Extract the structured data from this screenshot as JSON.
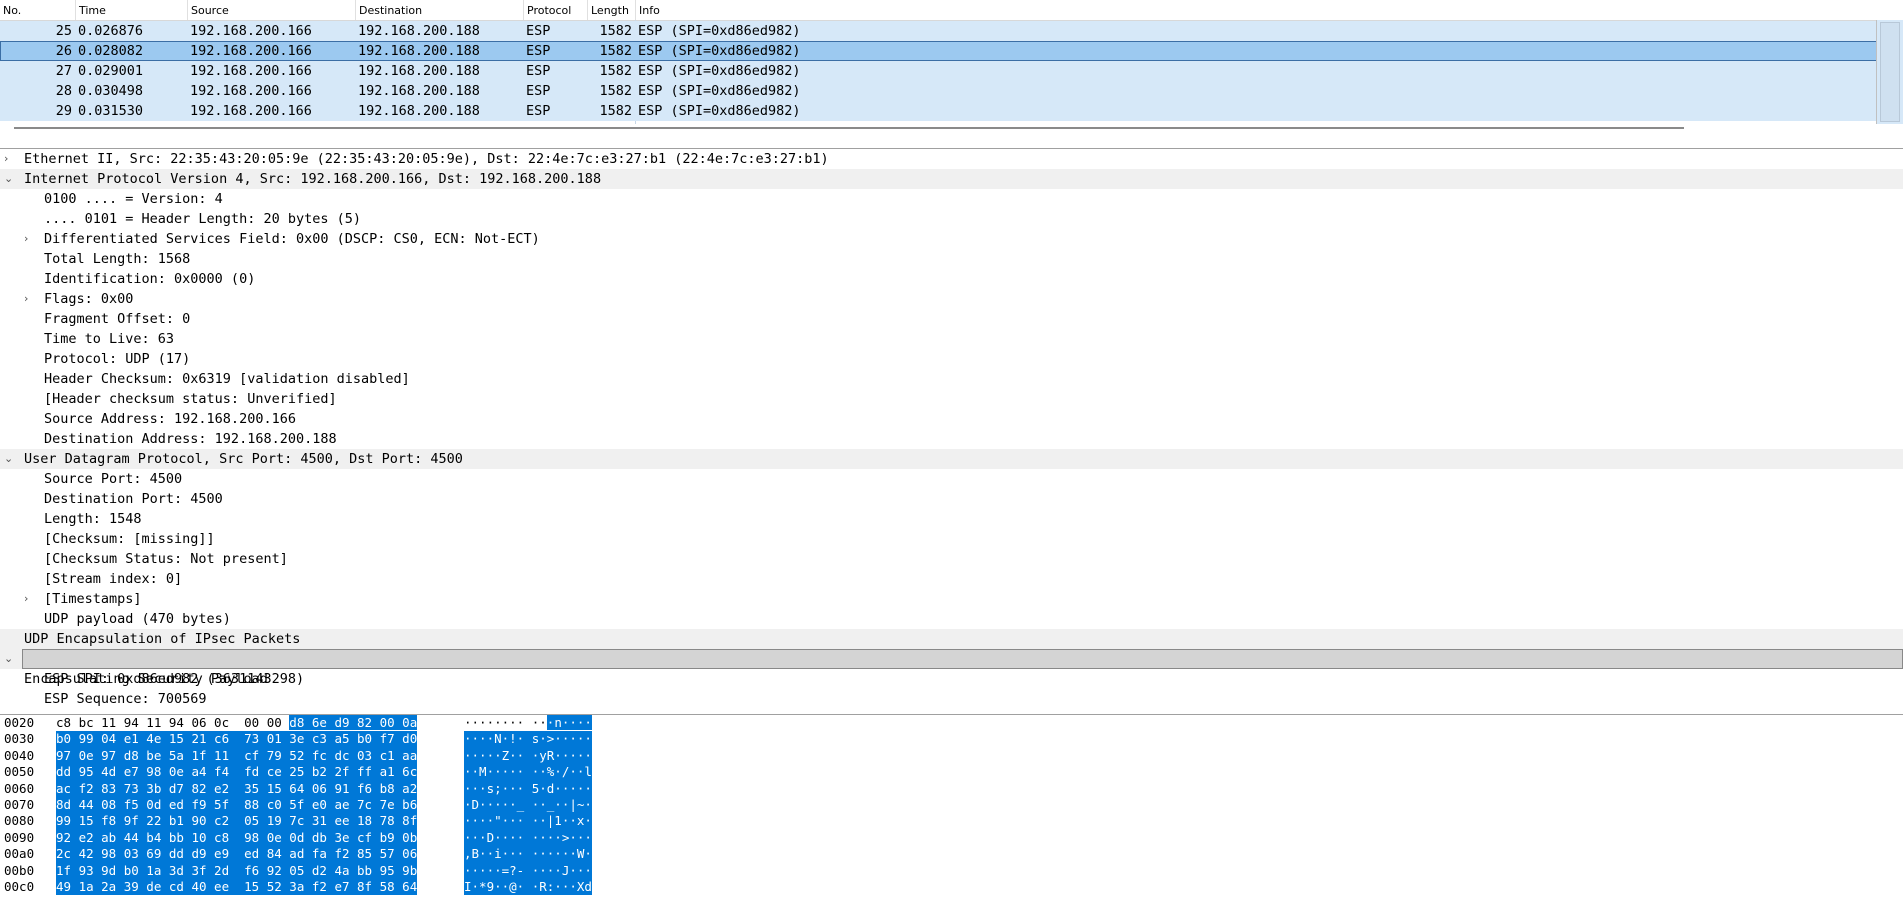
{
  "packet_list": {
    "columns": [
      "No.",
      "Time",
      "Source",
      "Destination",
      "Protocol",
      "Length",
      "Info"
    ],
    "rows": [
      {
        "no": "25",
        "time": "0.026876",
        "src": "192.168.200.166",
        "dst": "192.168.200.188",
        "proto": "ESP",
        "len": "1582",
        "info": "ESP (SPI=0xd86ed982)"
      },
      {
        "no": "26",
        "time": "0.028082",
        "src": "192.168.200.166",
        "dst": "192.168.200.188",
        "proto": "ESP",
        "len": "1582",
        "info": "ESP (SPI=0xd86ed982)"
      },
      {
        "no": "27",
        "time": "0.029001",
        "src": "192.168.200.166",
        "dst": "192.168.200.188",
        "proto": "ESP",
        "len": "1582",
        "info": "ESP (SPI=0xd86ed982)"
      },
      {
        "no": "28",
        "time": "0.030498",
        "src": "192.168.200.166",
        "dst": "192.168.200.188",
        "proto": "ESP",
        "len": "1582",
        "info": "ESP (SPI=0xd86ed982)"
      },
      {
        "no": "29",
        "time": "0.031530",
        "src": "192.168.200.166",
        "dst": "192.168.200.188",
        "proto": "ESP",
        "len": "1582",
        "info": "ESP (SPI=0xd86ed982)"
      }
    ]
  },
  "details": {
    "rows": [
      {
        "text": "Ethernet II, Src: 22:35:43:20:05:9e (22:35:43:20:05:9e), Dst: 22:4e:7c:e3:27:b1 (22:4e:7c:e3:27:b1)"
      },
      {
        "text": "Internet Protocol Version 4, Src: 192.168.200.166, Dst: 192.168.200.188"
      },
      {
        "text": "0100 .... = Version: 4"
      },
      {
        "text": ".... 0101 = Header Length: 20 bytes (5)"
      },
      {
        "text": "Differentiated Services Field: 0x00 (DSCP: CS0, ECN: Not-ECT)"
      },
      {
        "text": "Total Length: 1568"
      },
      {
        "text": "Identification: 0x0000 (0)"
      },
      {
        "text": "Flags: 0x00"
      },
      {
        "text": "Fragment Offset: 0"
      },
      {
        "text": "Time to Live: 63"
      },
      {
        "text": "Protocol: UDP (17)"
      },
      {
        "text": "Header Checksum: 0x6319 [validation disabled]"
      },
      {
        "text": "[Header checksum status: Unverified]"
      },
      {
        "text": "Source Address: 192.168.200.166"
      },
      {
        "text": "Destination Address: 192.168.200.188"
      },
      {
        "text": "User Datagram Protocol, Src Port: 4500, Dst Port: 4500"
      },
      {
        "text": "Source Port: 4500"
      },
      {
        "text": "Destination Port: 4500"
      },
      {
        "text": "Length: 1548"
      },
      {
        "text": "[Checksum: [missing]]"
      },
      {
        "text": "[Checksum Status: Not present]"
      },
      {
        "text": "[Stream index: 0]"
      },
      {
        "text": "[Timestamps]"
      },
      {
        "text": "UDP payload (470 bytes)"
      },
      {
        "text": "UDP Encapsulation of IPsec Packets"
      },
      {
        "text": "Encapsulating Security Payload"
      },
      {
        "text": "ESP SPI: 0xd86ed982 (3631143298)"
      },
      {
        "text": "ESP Sequence: 700569"
      }
    ],
    "arrow_expanded": "⌄",
    "arrow_collapsed": "›"
  },
  "bytes": {
    "rows": [
      {
        "off": "0020",
        "hex_plain": "c8 bc 11 94 11 94 06 0c  00 00 ",
        "hex_sel": "d8 6e d9 82 00 0a",
        "ascii_plain": "········ ··",
        "ascii_sel": "·n····"
      },
      {
        "off": "0030",
        "hex_plain": "",
        "hex_sel": "b0 99 04 e1 4e 15 21 c6  73 01 3e c3 a5 b0 f7 d0",
        "ascii_plain": "",
        "ascii_sel": "····N·!· s·>·····"
      },
      {
        "off": "0040",
        "hex_plain": "",
        "hex_sel": "97 0e 97 d8 be 5a 1f 11  cf 79 52 fc dc 03 c1 aa",
        "ascii_plain": "",
        "ascii_sel": "·····Z·· ·yR·····"
      },
      {
        "off": "0050",
        "hex_plain": "",
        "hex_sel": "dd 95 4d e7 98 0e a4 f4  fd ce 25 b2 2f ff a1 6c",
        "ascii_plain": "",
        "ascii_sel": "··M····· ··%·/··l"
      },
      {
        "off": "0060",
        "hex_plain": "",
        "hex_sel": "ac f2 83 73 3b d7 82 e2  35 15 64 06 91 f6 b8 a2",
        "ascii_plain": "",
        "ascii_sel": "···s;··· 5·d·····"
      },
      {
        "off": "0070",
        "hex_plain": "",
        "hex_sel": "8d 44 08 f5 0d ed f9 5f  88 c0 5f e0 ae 7c 7e b6",
        "ascii_plain": "",
        "ascii_sel": "·D·····_ ··_··|~·"
      },
      {
        "off": "0080",
        "hex_plain": "",
        "hex_sel": "99 15 f8 9f 22 b1 90 c2  05 19 7c 31 ee 18 78 8f",
        "ascii_plain": "",
        "ascii_sel": "····\"··· ··|1··x·"
      },
      {
        "off": "0090",
        "hex_plain": "",
        "hex_sel": "92 e2 ab 44 b4 bb 10 c8  98 0e 0d db 3e cf b9 0b",
        "ascii_plain": "",
        "ascii_sel": "···D···· ····>···"
      },
      {
        "off": "00a0",
        "hex_plain": "",
        "hex_sel": "2c 42 98 03 69 dd d9 e9  ed 84 ad fa f2 85 57 06",
        "ascii_plain": "",
        "ascii_sel": ",B··i··· ······W·"
      },
      {
        "off": "00b0",
        "hex_plain": "",
        "hex_sel": "1f 93 9d b0 1a 3d 3f 2d  f6 92 05 d2 4a bb 95 9b",
        "ascii_plain": "",
        "ascii_sel": "·····=?- ····J···"
      },
      {
        "off": "00c0",
        "hex_plain": "",
        "hex_sel": "49 1a 2a 39 de cd 40 ee  15 52 3a f2 e7 8f 58 64",
        "ascii_plain": "",
        "ascii_sel": "I·*9··@· ·R:···Xd"
      }
    ]
  }
}
